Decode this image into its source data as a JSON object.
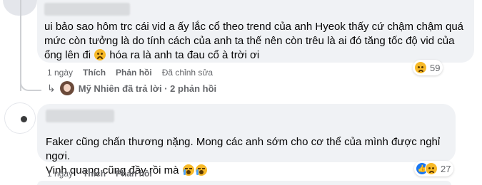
{
  "comment1": {
    "author_name_hidden": true,
    "lines": [
      "ui bảo sao hôm trc cái vid a ấy lắc cổ theo trend của anh Hyeok thấy cứ chậm chậm quá",
      "mức còn tưởng là do tính cách của anh ta thế nên còn trêu là ai đó tăng tốc độ vid của",
      "ổng lên đi",
      "hóa ra là anh ta đau cổ à trời ơi"
    ],
    "inline_emoji": "sad-emoji",
    "time": "1 ngày",
    "like_label": "Thích",
    "reply_label": "Phản hồi",
    "edited_label": "Đã chỉnh sửa",
    "reaction_count": "59",
    "reaction_icon": "sad-reaction-icon"
  },
  "reply_summary": {
    "text": "Mỹ Nhiên đã trả lời · 2 phản hồi"
  },
  "comment2": {
    "author_name_hidden": true,
    "lines": [
      "Faker cũng chấn thương nặng. Mong các anh sớm cho cơ thể của mình được nghỉ ngơi.",
      "Vinh quang cũng đầy rồi mà"
    ],
    "inline_emoji": "crying-emoji",
    "time": "1 ngày",
    "like_label": "Thích",
    "reply_label": "Phản hồi",
    "reaction_count": "27",
    "reaction_icons": [
      "like-reaction-icon",
      "sad-reaction-icon"
    ]
  },
  "colors": {
    "bubble": "#f0f2f5",
    "meta_text": "#65676b",
    "like_blue": "#1877f2"
  }
}
